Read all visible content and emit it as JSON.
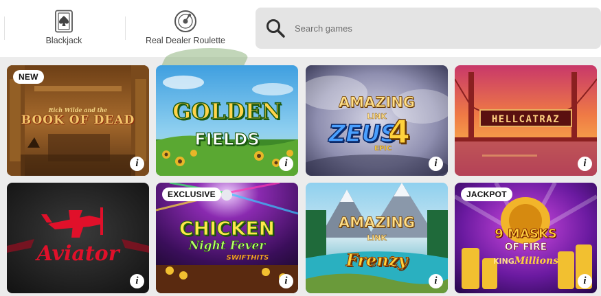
{
  "categories": [
    {
      "label": "Blackjack",
      "icon": "spade-card-icon"
    },
    {
      "label": "Real Dealer Roulette",
      "icon": "roulette-wheel-icon"
    }
  ],
  "search": {
    "placeholder": "Search games"
  },
  "games": [
    {
      "title_top": "Rich Wilde and the",
      "title": "BOOK OF DEAD",
      "badge": "NEW"
    },
    {
      "title": "GOLDEN",
      "title2": "FIELDS"
    },
    {
      "title": "AMAZING",
      "title2": "LINK",
      "title3": "ZEUS",
      "title4": "4",
      "title5": "EPIC"
    },
    {
      "title": "HELLCATRAZ"
    },
    {
      "title": "Aviator"
    },
    {
      "title": "CHICKEN",
      "title2": "Night Fever",
      "title3": "SWIFTHITS",
      "badge": "EXCLUSIVE"
    },
    {
      "title": "AMAZING",
      "title2": "LINK",
      "title3": "Frenzy"
    },
    {
      "title": "9 MASKS",
      "title2": "OF FIRE",
      "title3": "KING",
      "title4": "Millions",
      "badge": "JACKPOT"
    }
  ],
  "info_label": "i"
}
